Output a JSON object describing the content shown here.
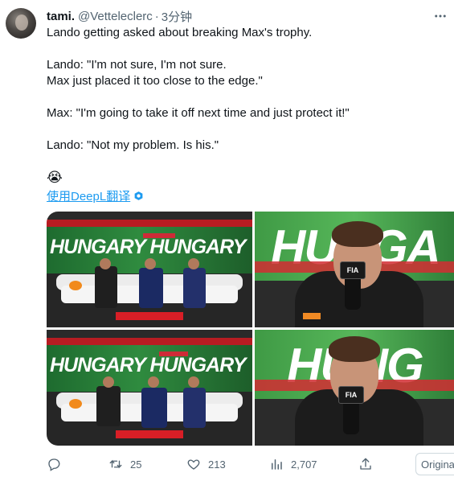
{
  "tweet": {
    "display_name": "tami.",
    "handle": "@Vetteleclerc",
    "separator": "·",
    "time": "3分钟",
    "text": "Lando getting asked about breaking Max's trophy.\n\nLando: \"I'm not sure, I'm not sure.\nMax just placed it too close to the edge.\"\n\nMax: \"I'm going to take it off next time and just protect it!\"\n\nLando: \"Not my problem. Is his.\"",
    "emoji": "😭",
    "translate_label": "使用DeepL翻译"
  },
  "media": {
    "banner_text": "HUNGARY HUNGARY",
    "banner_small": "HUNGARY",
    "closeup_text_1": "HUNGA",
    "closeup_text_2": "HUNG",
    "mic_label": "FIA"
  },
  "actions": {
    "reply_count": "",
    "retweet_count": "25",
    "like_count": "213",
    "view_count": "2,707",
    "original_label": "Original"
  },
  "icons": {
    "more": "more-icon",
    "reply": "reply-icon",
    "retweet": "retweet-icon",
    "like": "heart-icon",
    "views": "views-icon",
    "share": "share-icon",
    "translate": "deepl-icon"
  },
  "colors": {
    "link": "#1d9bf0",
    "muted": "#536471",
    "text": "#0f1419"
  }
}
